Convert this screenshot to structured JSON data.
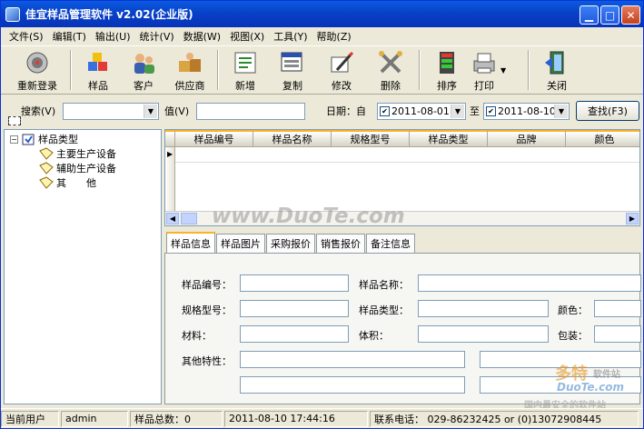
{
  "window": {
    "title": "佳宜样品管理软件 v2.02(企业版)"
  },
  "menu": [
    "文件(S)",
    "编辑(T)",
    "输出(U)",
    "统计(V)",
    "数据(W)",
    "视图(X)",
    "工具(Y)",
    "帮助(Z)"
  ],
  "toolbar": {
    "relogin": "重新登录",
    "sample": "样品",
    "customer": "客户",
    "supplier": "供应商",
    "add": "新增",
    "copy": "复制",
    "edit": "修改",
    "delete": "删除",
    "sort": "排序",
    "print": "打印",
    "close": "关闭"
  },
  "search": {
    "search_label": "搜索(V)",
    "value_label": "值(V)",
    "date_label": "日期：自",
    "date_from": "2011-08-01",
    "to_label": "至",
    "date_to": "2011-08-10",
    "find_button": "查找(F3)"
  },
  "tree": {
    "root": "样品类型",
    "items": [
      "主要生产设备",
      "辅助生产设备",
      "其　　他"
    ]
  },
  "grid": {
    "columns": [
      "样品编号",
      "样品名称",
      "规格型号",
      "样品类型",
      "品牌",
      "颜色"
    ]
  },
  "tabs": [
    "样品信息",
    "样品图片",
    "采购报价",
    "销售报价",
    "备注信息"
  ],
  "form": {
    "sample_no": "样品编号：",
    "sample_name": "样品名称：",
    "model": "规格型号：",
    "sample_type": "样品类型：",
    "color": "颜色：",
    "material": "材料：",
    "volume": "体积：",
    "packaging": "包装：",
    "other": "其他特性："
  },
  "status": {
    "current_user_label": "当前用户",
    "user": "admin",
    "total": "样品总数：0",
    "datetime": "2011-08-10 17:44:16",
    "contact": "联系电话：  029-86232425 or (0)13072908445"
  },
  "watermarks": {
    "center": "www.DuoTe.com",
    "brand": "多特",
    "brand_en": "软件站",
    "site": "DuoTe.com",
    "slogan": "国内最安全的软件站"
  }
}
